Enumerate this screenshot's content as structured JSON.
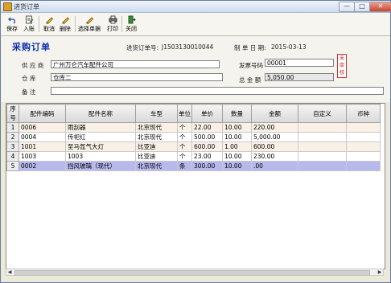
{
  "window": {
    "title": "进货订单",
    "btn_min": "—",
    "btn_max": "□",
    "btn_close": "✕"
  },
  "toolbar": [
    {
      "name": "save-button",
      "label": "保存",
      "icon": "undo-arrow-icon"
    },
    {
      "name": "post-button",
      "label": "入账",
      "icon": "document-edit-icon"
    },
    {
      "name": "cancel-button",
      "label": "取消",
      "icon": "pencil-icon"
    },
    {
      "name": "delete-button",
      "label": "删除",
      "icon": "pencil-icon"
    },
    {
      "name": "select-document-button",
      "label": "选择单据",
      "icon": "pencil-icon"
    },
    {
      "name": "print-button",
      "label": "打印",
      "icon": "printer-icon"
    },
    {
      "name": "close-button",
      "label": "关闭",
      "icon": "exit-door-icon"
    }
  ],
  "form": {
    "heading": "采购订单",
    "order_no_label": "进货订单号:",
    "order_no": "J1503130010044",
    "date_label": "制 单 日 期:",
    "date": "2015-03-13",
    "supplier_label": "供  应  商",
    "supplier": "广州万仑汽车配件公司",
    "invoice_label": "发票号码",
    "invoice": "00001",
    "warehouse_label": "仓      库",
    "warehouse": "仓库二",
    "amount_label": "总 金 额",
    "amount": "5,050.00",
    "remark_label": "备      注",
    "remark": "",
    "stamp": "未审核"
  },
  "table": {
    "columns": [
      "序号",
      "配件编码",
      "配件名称",
      "车型",
      "单位",
      "单价",
      "数量",
      "金额",
      "自定义",
      "币种"
    ],
    "rows": [
      [
        "1",
        "0006",
        "雨刮器",
        "北京现代",
        "个",
        "22.00",
        "10.00",
        "220.00",
        "",
        ""
      ],
      [
        "2",
        "0004",
        "传祀红",
        "北京现代",
        "个",
        "500.00",
        "10.00",
        "5,000.00",
        "",
        ""
      ],
      [
        "3",
        "1001",
        "至马氙气大灯",
        "比亚迪",
        "个",
        "600.00",
        "1.00",
        "600.00",
        "",
        ""
      ],
      [
        "4",
        "1003",
        "1003",
        "比亚迪",
        "个",
        "23.00",
        "10.00",
        "230.00",
        "",
        ""
      ],
      [
        "5",
        "0002",
        "挡风玻璃（现代）",
        "北京现代",
        "条",
        "300.00",
        "10.00",
        ".00",
        "",
        ""
      ]
    ],
    "selected_row": 4
  },
  "colors": {
    "heading": "#0b2fb0",
    "selected_row": "#b7b8ec",
    "alt_row": "#f9f1e6"
  }
}
